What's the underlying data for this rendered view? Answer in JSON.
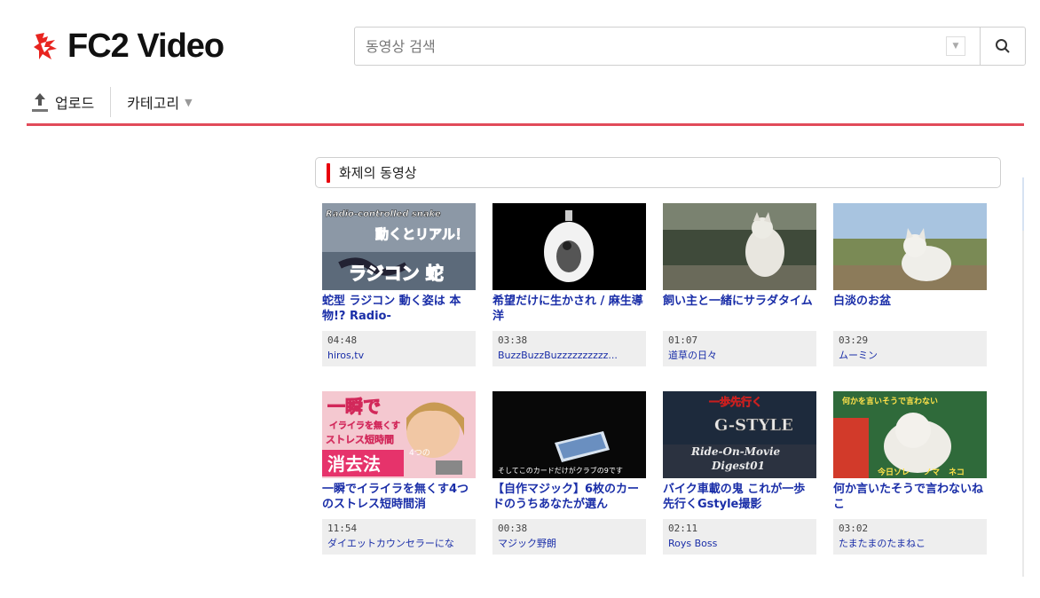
{
  "header": {
    "logo_text": "FC2 Video",
    "search_placeholder": "동영상 검색",
    "upload_label": "업로드",
    "category_label": "카테고리"
  },
  "section": {
    "title": "화제의 동영상"
  },
  "videos": [
    {
      "title": "蛇型 ラジコン 動く姿は 本物!? Radio-",
      "duration": "04:48",
      "user": "hiros,tv",
      "thumb_text": [
        "Radio-controlled snake",
        "動くとリアル！",
        "ラジコン 蛇"
      ]
    },
    {
      "title": "希望だけに生かされ / 麻生導洋",
      "duration": "03:38",
      "user": "BuzzBuzzBuzzzzzzzzzz...",
      "thumb_text": []
    },
    {
      "title": "飼い主と一緒にサラダタイム",
      "duration": "01:07",
      "user": "道草の日々",
      "thumb_text": []
    },
    {
      "title": "白淡のお盆",
      "duration": "03:29",
      "user": "ムーミン",
      "thumb_text": []
    },
    {
      "title": "一瞬でイライラを無くす4つのストレス短時間消",
      "duration": "11:54",
      "user": "ダイエットカウンセラーにな",
      "thumb_text": [
        "一瞬で",
        "イライラを無くす",
        "ストレス短時間",
        "消去法",
        "4つの"
      ]
    },
    {
      "title": "【自作マジック】6枚のカードのうちあなたが選ん",
      "duration": "00:38",
      "user": "マジック野朗",
      "thumb_text": [
        "そしてこのカードだけがクラブの9です"
      ]
    },
    {
      "title": "バイク車載の鬼 これが一歩先行くGstyle撮影",
      "duration": "02:11",
      "user": "Roys Boss",
      "thumb_text": [
        "一歩先行く",
        "G-STYLE",
        "Ride-On-Movie",
        "Digest01"
      ]
    },
    {
      "title": "何か言いたそうで言わないねこ",
      "duration": "03:02",
      "user": "たまたまのたまねこ",
      "thumb_text": [
        "何かを言いそうで言わない",
        "今日ソレ",
        "ノマ",
        "ネコ"
      ]
    }
  ],
  "colors": {
    "accent_red": "#e14b5a",
    "link_blue": "#1a2ea8",
    "section_bar": "#e8000b"
  }
}
